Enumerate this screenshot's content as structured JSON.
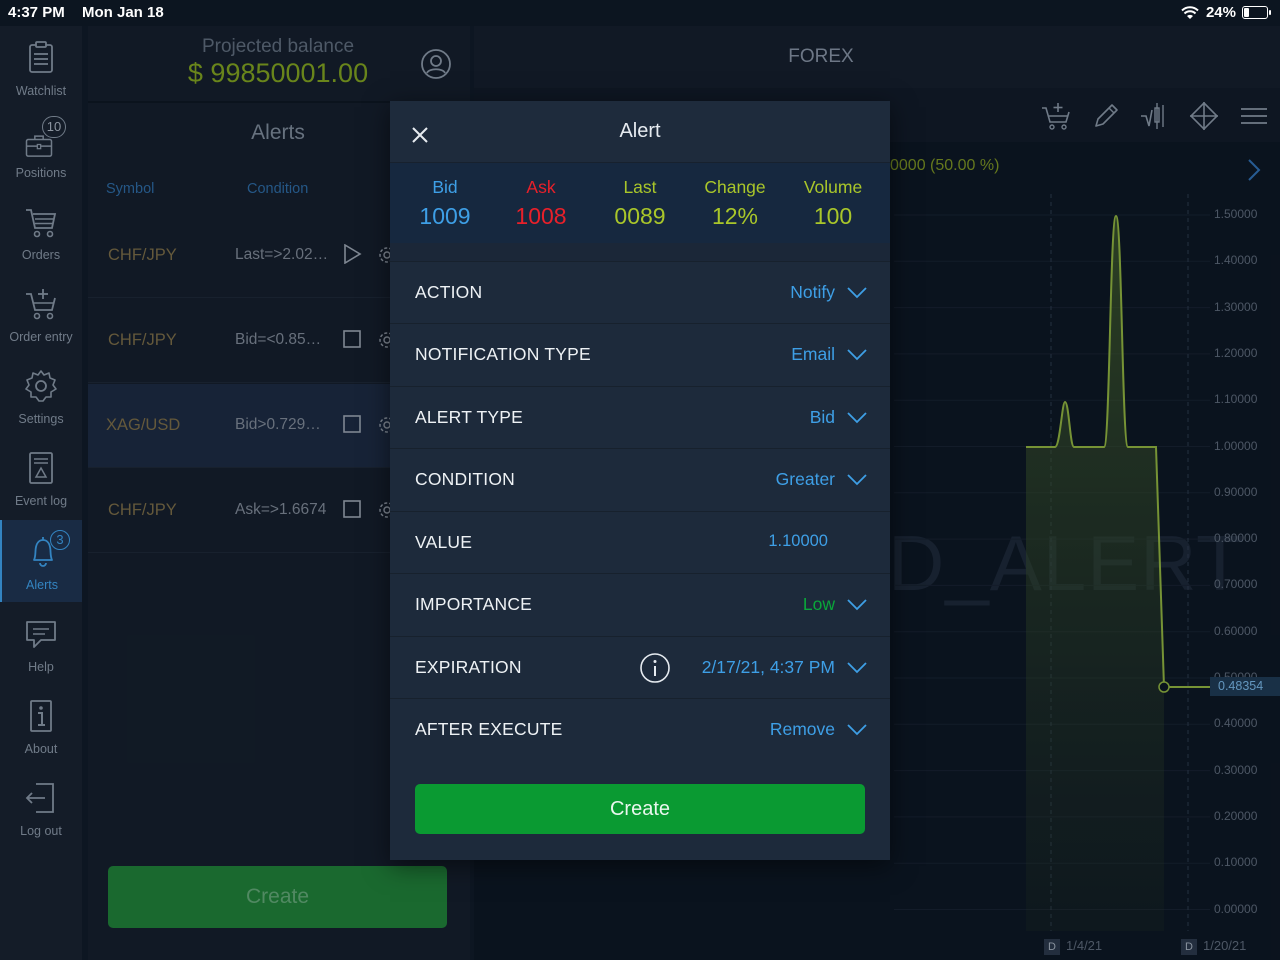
{
  "status_bar": {
    "time": "4:37 PM",
    "date": "Mon Jan 18",
    "battery": "24%",
    "battery_level": 0.24
  },
  "sidebar": {
    "items": [
      {
        "label": "Watchlist",
        "icon": "watchlist-icon"
      },
      {
        "label": "Positions",
        "icon": "briefcase-icon",
        "badge": "10"
      },
      {
        "label": "Orders",
        "icon": "cart-icon"
      },
      {
        "label": "Order entry",
        "icon": "cart-add-icon"
      },
      {
        "label": "Settings",
        "icon": "gear-icon"
      },
      {
        "label": "Event log",
        "icon": "event-log-icon"
      },
      {
        "label": "Alerts",
        "icon": "bell-icon",
        "badge": "3",
        "active": true
      },
      {
        "label": "Help",
        "icon": "help-chat-icon"
      },
      {
        "label": "About",
        "icon": "info-icon"
      },
      {
        "label": "Log out",
        "icon": "logout-icon"
      }
    ]
  },
  "balance": {
    "label": "Projected balance",
    "value": "$ 99850001.00"
  },
  "alerts_panel": {
    "title": "Alerts",
    "columns": {
      "symbol": "Symbol",
      "condition": "Condition"
    },
    "rows": [
      {
        "symbol": "CHF/JPY",
        "condition": "Last=>2.02…",
        "control": "play"
      },
      {
        "symbol": "CHF/JPY",
        "condition": "Bid=<0.85…",
        "control": "checkbox"
      },
      {
        "symbol": "XAG/USD",
        "condition": "Bid>0.729…",
        "control": "checkbox",
        "selected": true
      },
      {
        "symbol": "CHF/JPY",
        "condition": "Ask=>1.6674",
        "control": "checkbox"
      }
    ],
    "create_label": "Create"
  },
  "chart": {
    "title": "FOREX",
    "info_text": "0000 (50.00 %)",
    "watermark": "D_ALERT",
    "current_price": "0.48354",
    "y_ticks": [
      "1.50000",
      "1.40000",
      "1.30000",
      "1.20000",
      "1.10000",
      "1.00000",
      "0.90000",
      "0.80000",
      "0.70000",
      "0.60000",
      "0.50000",
      "0.40000",
      "0.30000",
      "0.20000",
      "0.10000",
      "0.00000"
    ],
    "x_ticks": [
      {
        "box": "D",
        "label": "1/4/21"
      },
      {
        "box": "D",
        "label": "1/20/21"
      }
    ]
  },
  "colors": {
    "accent_blue": "#3e9fe6",
    "ask_red": "#e8202a",
    "lime": "#a9c62a",
    "create_green": "#0a9a32",
    "line_green": "#8fb23e"
  },
  "modal": {
    "title": "Alert",
    "quote": {
      "bid_label": "Bid",
      "bid_value": "1009",
      "ask_label": "Ask",
      "ask_value": "1008",
      "last_label": "Last",
      "last_value": "0089",
      "change_label": "Change",
      "change_value": "12%",
      "volume_label": "Volume",
      "volume_value": "100"
    },
    "fields": {
      "action": {
        "label": "ACTION",
        "value": "Notify"
      },
      "notification_type": {
        "label": "NOTIFICATION TYPE",
        "value": "Email"
      },
      "alert_type": {
        "label": "ALERT TYPE",
        "value": "Bid"
      },
      "condition": {
        "label": "CONDITION",
        "value": "Greater"
      },
      "value": {
        "label": "VALUE",
        "value": "1.10000"
      },
      "importance": {
        "label": "IMPORTANCE",
        "value": "Low"
      },
      "expiration": {
        "label": "EXPIRATION",
        "value": "2/17/21, 4:37 PM"
      },
      "after_execute": {
        "label": "AFTER EXECUTE",
        "value": "Remove"
      }
    },
    "create_label": "Create"
  }
}
